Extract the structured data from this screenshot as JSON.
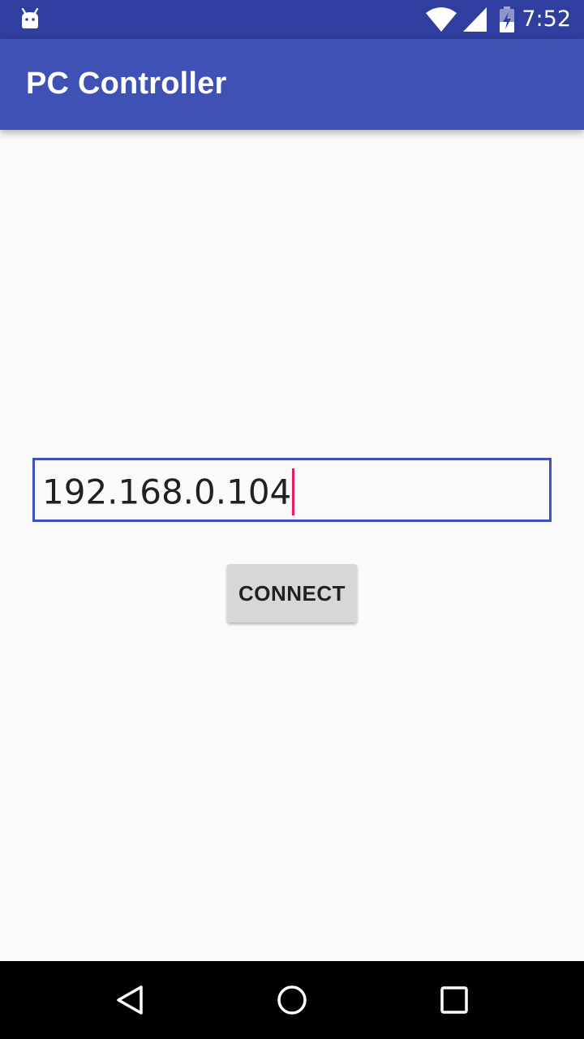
{
  "status_bar": {
    "time": "7:52",
    "icons": [
      "android-debug-icon",
      "wifi-icon",
      "cell-signal-icon",
      "battery-charging-icon"
    ],
    "background_color": "#303f9f"
  },
  "app_bar": {
    "title": "PC Controller",
    "background_color": "#3f51b5"
  },
  "main": {
    "ip_input": {
      "value": "192.168.0.104",
      "focused": true,
      "border_color": "#3f51b5",
      "cursor_color": "#e91e63"
    },
    "connect_button": {
      "label": "CONNECT",
      "background_color": "#d6d7d7"
    }
  },
  "nav_bar": {
    "buttons": [
      "back-icon",
      "home-icon",
      "recents-icon"
    ],
    "background_color": "#000000"
  }
}
